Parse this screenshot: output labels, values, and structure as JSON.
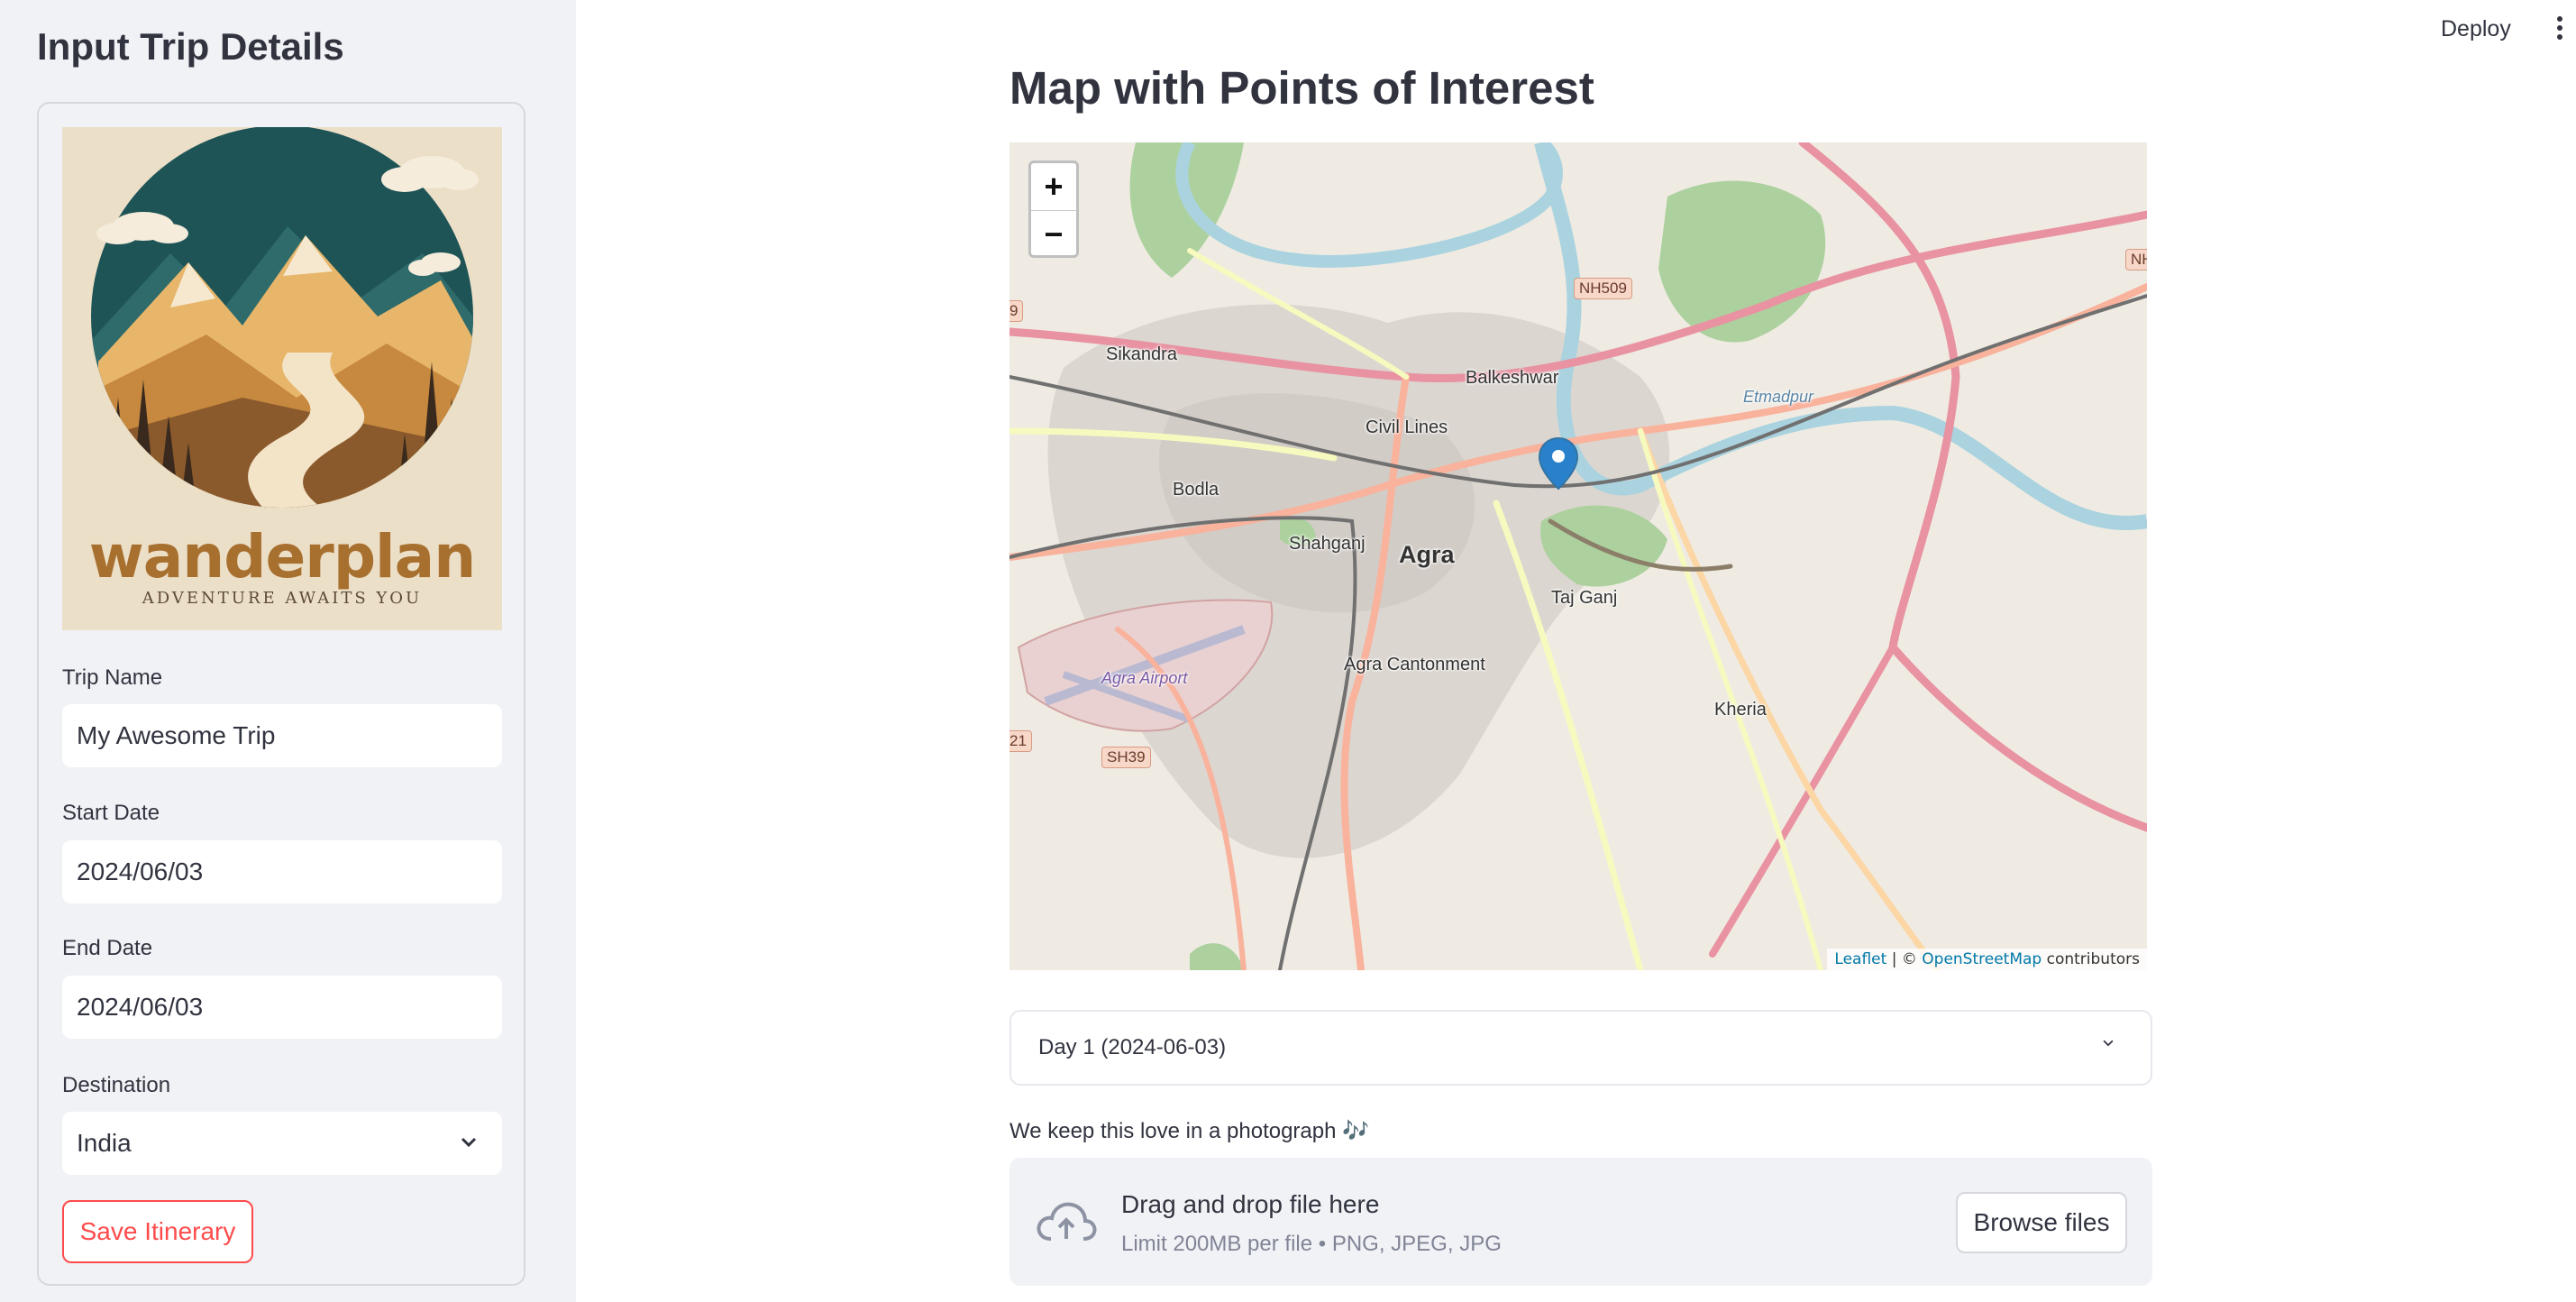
{
  "sidebar": {
    "title": "Input Trip Details",
    "logo": {
      "wordmark": "wanderplan",
      "tagline": "ADVENTURE AWAITS YOU"
    },
    "fields": {
      "trip_name": {
        "label": "Trip Name",
        "value": "My Awesome Trip"
      },
      "start_date": {
        "label": "Start Date",
        "value": "2024/06/03"
      },
      "end_date": {
        "label": "End Date",
        "value": "2024/06/03"
      },
      "destination": {
        "label": "Destination",
        "value": "India"
      }
    },
    "save_label": "Save Itinerary"
  },
  "header": {
    "deploy_label": "Deploy",
    "menu_icon": "kebab-menu-icon"
  },
  "main": {
    "title": "Map with Points of Interest",
    "map": {
      "zoom_in": "+",
      "zoom_out": "−",
      "places": {
        "sikandra": "Sikandra",
        "balkeshwar": "Balkeshwar",
        "civil_lines": "Civil Lines",
        "bodla": "Bodla",
        "shahganj": "Shahganj",
        "agra": "Agra",
        "taj_ganj": "Taj Ganj",
        "agra_cantonment": "Agra Cantonment",
        "kheria": "Kheria",
        "agra_airport": "Agra Airport",
        "etmadpur": "Etmadpur"
      },
      "road_shields": {
        "nh509": "NH509",
        "sh39": "SH39",
        "nh_edge": "NH",
        "left_top": "9",
        "left_bottom": "21"
      },
      "attribution": {
        "leaflet": "Leaflet",
        "sep": " | © ",
        "osm": "OpenStreetMap",
        "contributors": " contributors"
      },
      "marker_icon": "map-pin-icon"
    },
    "day_expander": {
      "label": "Day 1 (2024-06-03)"
    },
    "uploader": {
      "label": "We keep this love in a photograph 🎶",
      "title": "Drag and drop file here",
      "limits": "Limit 200MB per file • PNG, JPEG, JPG",
      "browse_label": "Browse files",
      "icon": "cloud-upload-icon"
    }
  },
  "colors": {
    "accent": "#ff4b4b",
    "sidebar_bg": "#f0f2f6",
    "marker": "#2a81cb"
  }
}
